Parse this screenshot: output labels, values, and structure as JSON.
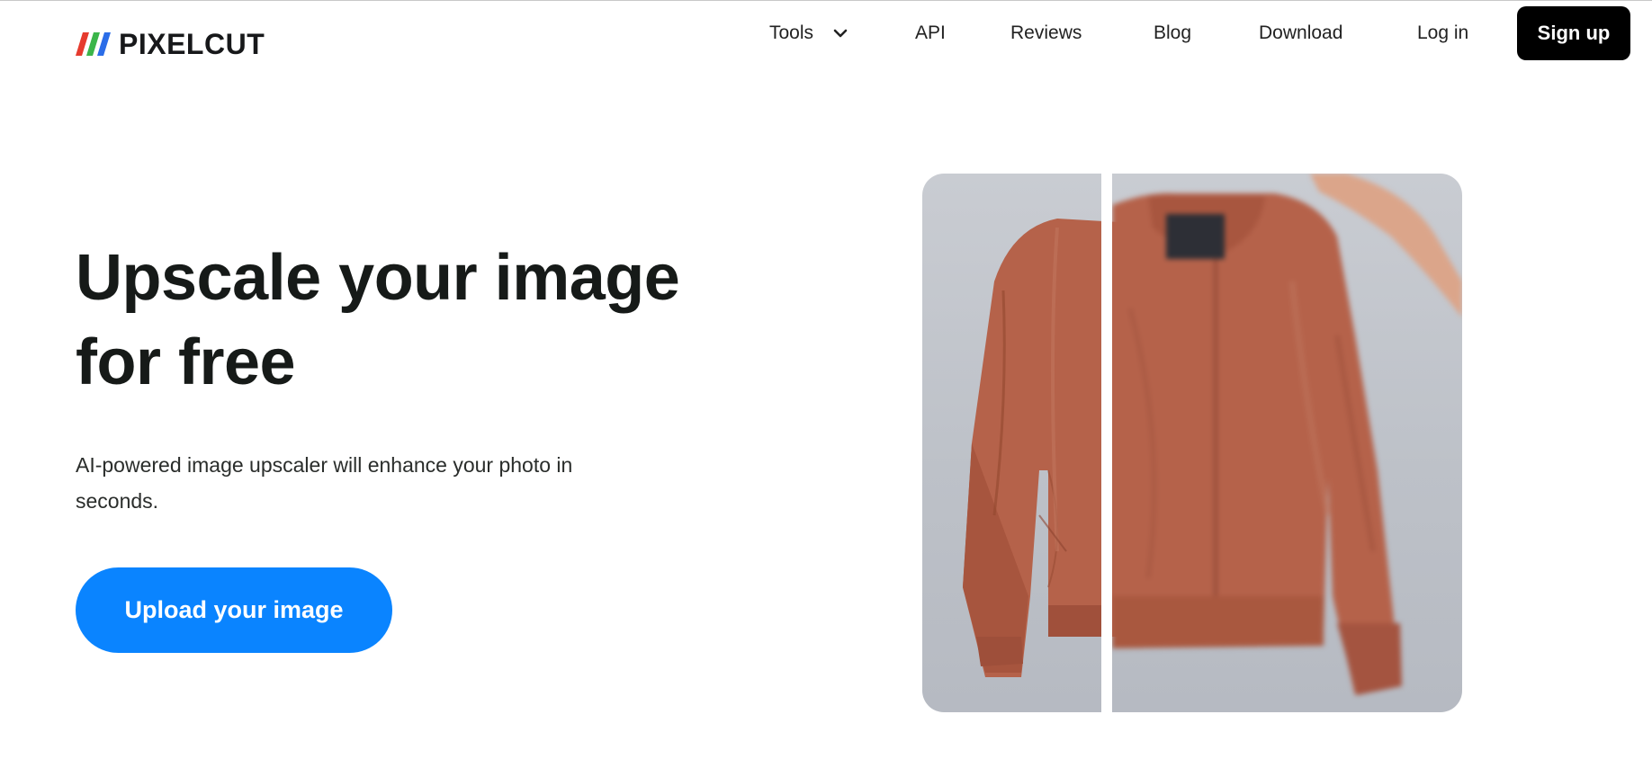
{
  "brand": {
    "name": "PIXELCUT"
  },
  "nav": {
    "tools": "Tools",
    "api": "API",
    "reviews": "Reviews",
    "blog": "Blog",
    "download": "Download",
    "login": "Log in",
    "signup": "Sign up"
  },
  "hero": {
    "title_line1": "Upscale your image",
    "title_line2": "for free",
    "subtitle_line1": "AI-powered image upscaler will enhance your photo in",
    "subtitle_line2": "seconds.",
    "cta": "Upload your image"
  },
  "icons": {
    "tools_dropdown": "chevron-down-icon",
    "logo": "pixelcut-logo-icon"
  },
  "colors": {
    "primary": "#0a84ff",
    "signup_bg": "#000000",
    "jacket": "#b5624a",
    "logo_red": "#e63b2e",
    "logo_green": "#3bb54a",
    "logo_blue": "#2b6de8"
  }
}
